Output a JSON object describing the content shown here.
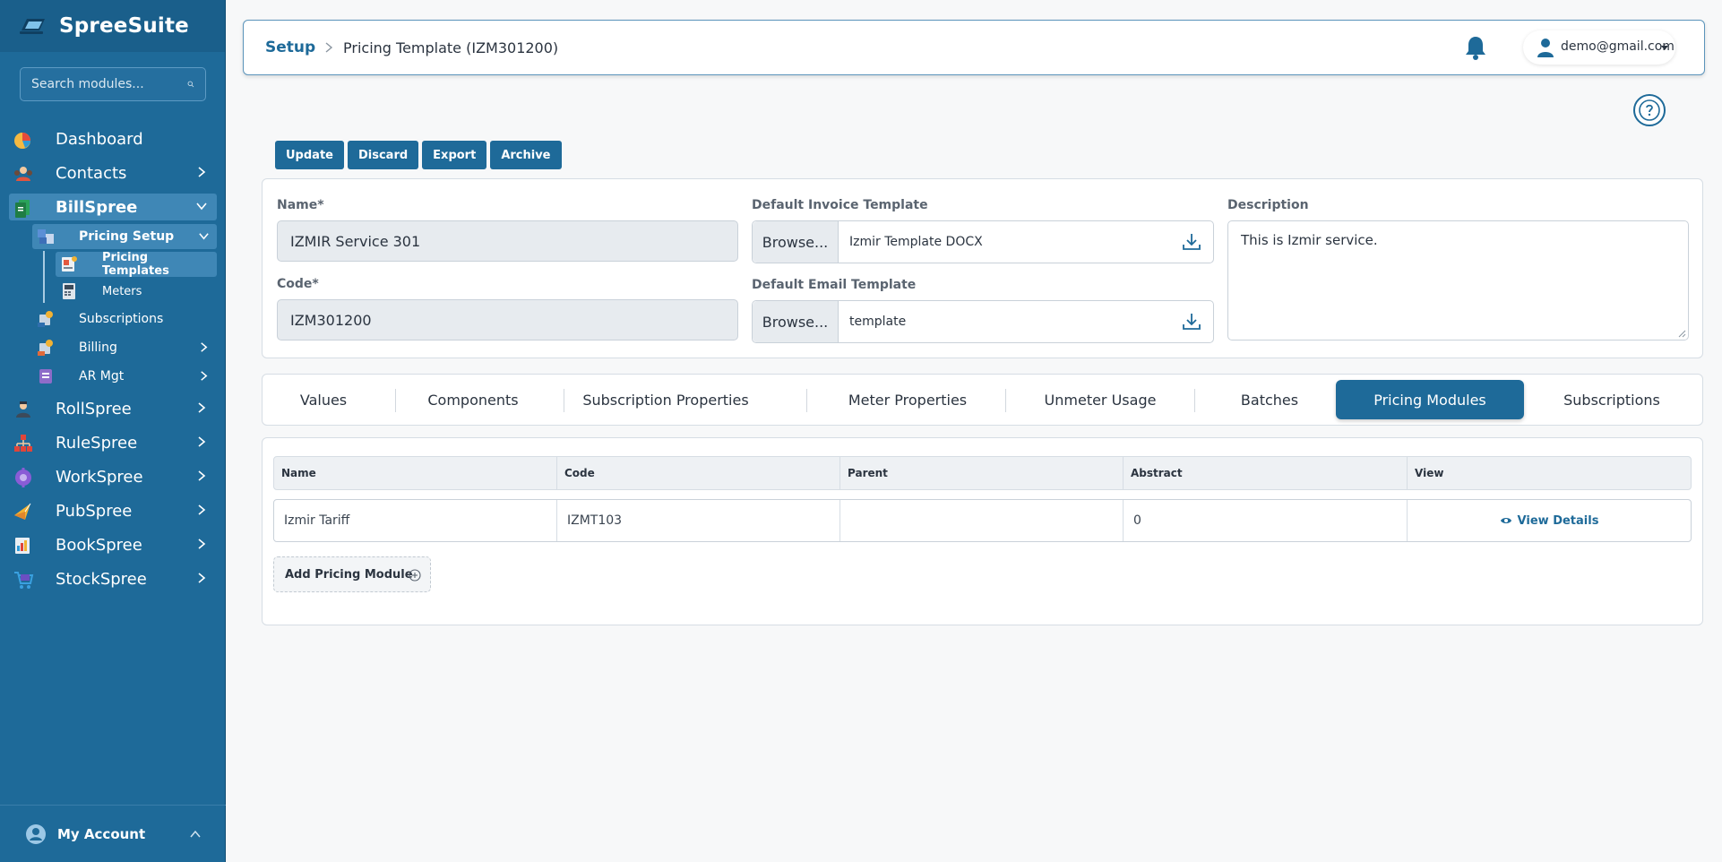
{
  "app": {
    "name": "SpreeSuite"
  },
  "sidebar": {
    "search_placeholder": "Search modules...",
    "items": [
      {
        "label": "Dashboard",
        "icon": "dashboard-pie-icon"
      },
      {
        "label": "Contacts",
        "icon": "contacts-people-icon"
      },
      {
        "label": "BillSpree",
        "icon": "billspree-doc-icon",
        "expanded": true
      },
      {
        "label": "RollSpree",
        "icon": "rollspree-worker-icon"
      },
      {
        "label": "RuleSpree",
        "icon": "rulespree-hierarchy-icon"
      },
      {
        "label": "WorkSpree",
        "icon": "workspree-gear-icon"
      },
      {
        "label": "PubSpree",
        "icon": "pubspree-megaphone-icon"
      },
      {
        "label": "BookSpree",
        "icon": "bookspree-ledger-icon"
      },
      {
        "label": "StockSpree",
        "icon": "stockspree-cart-icon"
      }
    ],
    "billspree_children": [
      {
        "label": "Pricing Setup",
        "icon": "pricing-setup-icon",
        "expanded": true
      },
      {
        "label": "Subscriptions",
        "icon": "subscriptions-icon"
      },
      {
        "label": "Billing",
        "icon": "billing-icon"
      },
      {
        "label": "AR Mgt",
        "icon": "ar-mgt-icon"
      }
    ],
    "pricing_children": [
      {
        "label": "Pricing Templates",
        "icon": "pricing-templates-icon",
        "active": true
      },
      {
        "label": "Meters",
        "icon": "meters-icon"
      }
    ],
    "account_label": "My Account"
  },
  "header": {
    "breadcrumb_root": "Setup",
    "breadcrumb_current": "Pricing Template (IZM301200)",
    "user_email": "demo@gmail.com"
  },
  "toolbar": {
    "update": "Update",
    "discard": "Discard",
    "export": "Export",
    "archive": "Archive"
  },
  "form": {
    "name_label": "Name*",
    "name_value": "IZMIR Service 301",
    "code_label": "Code*",
    "code_value": "IZM301200",
    "invoice_label": "Default Invoice Template",
    "invoice_browse": "Browse...",
    "invoice_file": "Izmir Template DOCX",
    "email_label": "Default Email Template",
    "email_browse": "Browse...",
    "email_file": "template",
    "description_label": "Description",
    "description_value": "This is Izmir service."
  },
  "tabs": [
    "Values",
    "Components",
    "Subscription Properties",
    "Meter Properties",
    "Unmeter Usage",
    "Batches",
    "Pricing Modules",
    "Subscriptions"
  ],
  "active_tab": "Pricing Modules",
  "table": {
    "columns": [
      "Name",
      "Code",
      "Parent",
      "Abstract",
      "View"
    ],
    "rows": [
      {
        "name": "Izmir Tariff",
        "code": "IZMT103",
        "parent": "",
        "abstract": "0",
        "view": "View Details"
      }
    ],
    "add_label": "Add Pricing Module"
  },
  "colors": {
    "sidebar_bg": "#1e6a99",
    "accent": "#1e6a99",
    "active_item": "#3f87b6"
  }
}
